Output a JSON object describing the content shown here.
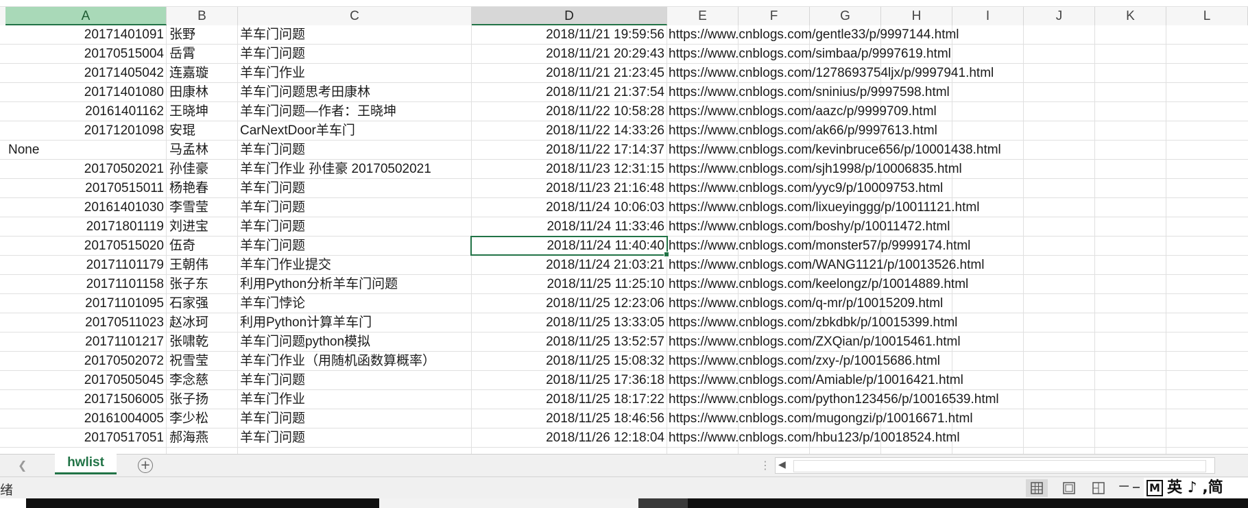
{
  "columns": [
    "A",
    "B",
    "C",
    "D",
    "E",
    "F",
    "G",
    "H",
    "I",
    "J",
    "K",
    "L"
  ],
  "rows": [
    {
      "a": "20171401091",
      "b": "张野",
      "c": "羊车门问题",
      "d": "2018/11/21 19:59:56",
      "e": "https://www.cnblogs.com/gentle33/p/9997144.html"
    },
    {
      "a": "20170515004",
      "b": "岳霄",
      "c": "羊车门问题",
      "d": "2018/11/21 20:29:43",
      "e": "https://www.cnblogs.com/simbaa/p/9997619.html"
    },
    {
      "a": "20171405042",
      "b": "连嘉璇",
      "c": "羊车门作业",
      "d": "2018/11/21 21:23:45",
      "e": "https://www.cnblogs.com/1278693754ljx/p/9997941.html"
    },
    {
      "a": "20171401080",
      "b": "田康林",
      "c": "羊车门问题思考田康林",
      "d": "2018/11/21 21:37:54",
      "e": "https://www.cnblogs.com/sninius/p/9997598.html"
    },
    {
      "a": "20161401162",
      "b": "王晓坤",
      "c": "羊车门问题—作者：王晓坤",
      "d": "2018/11/22 10:58:28",
      "e": "https://www.cnblogs.com/aazc/p/9999709.html"
    },
    {
      "a": "20171201098",
      "b": "安琨",
      "c": "CarNextDoor羊车门",
      "d": "2018/11/22 14:33:26",
      "e": "https://www.cnblogs.com/ak66/p/9997613.html"
    },
    {
      "a": "None",
      "b": "马孟林",
      "c": "羊车门问题",
      "d": "2018/11/22 17:14:37",
      "e": "https://www.cnblogs.com/kevinbruce656/p/10001438.html"
    },
    {
      "a": "20170502021",
      "b": "孙佳豪",
      "c": "羊车门作业 孙佳豪 20170502021",
      "d": "2018/11/23 12:31:15",
      "e": "https://www.cnblogs.com/sjh1998/p/10006835.html"
    },
    {
      "a": "20170515011",
      "b": "杨艳春",
      "c": "羊车门问题",
      "d": "2018/11/23 21:16:48",
      "e": "https://www.cnblogs.com/yyc9/p/10009753.html"
    },
    {
      "a": "20161401030",
      "b": "李雪莹",
      "c": "羊车门问题",
      "d": "2018/11/24 10:06:03",
      "e": "https://www.cnblogs.com/lixueyinggg/p/10011121.html"
    },
    {
      "a": "20171801119",
      "b": "刘进宝",
      "c": "羊车门问题",
      "d": "2018/11/24 11:33:46",
      "e": "https://www.cnblogs.com/boshy/p/10011472.html"
    },
    {
      "a": "20170515020",
      "b": "伍奇",
      "c": "羊车门问题",
      "d": "2018/11/24 11:40:40",
      "e": "https://www.cnblogs.com/monster57/p/9999174.html"
    },
    {
      "a": "20171101179",
      "b": "王朝伟",
      "c": "羊车门作业提交",
      "d": "2018/11/24 21:03:21",
      "e": "https://www.cnblogs.com/WANG1121/p/10013526.html"
    },
    {
      "a": "20171101158",
      "b": "张子东",
      "c": "利用Python分析羊车门问题",
      "d": "2018/11/25 11:25:10",
      "e": "https://www.cnblogs.com/keelongz/p/10014889.html"
    },
    {
      "a": "20171101095",
      "b": "石家强",
      "c": "羊车门悖论",
      "d": "2018/11/25 12:23:06",
      "e": "https://www.cnblogs.com/q-mr/p/10015209.html"
    },
    {
      "a": "20170511023",
      "b": "赵冰珂",
      "c": "利用Python计算羊车门",
      "d": "2018/11/25 13:33:05",
      "e": "https://www.cnblogs.com/zbkdbk/p/10015399.html"
    },
    {
      "a": "20171101217",
      "b": "张啸乾",
      "c": "羊车门问题python模拟",
      "d": "2018/11/25 13:52:57",
      "e": "https://www.cnblogs.com/ZXQian/p/10015461.html"
    },
    {
      "a": "20170502072",
      "b": "祝雪莹",
      "c": "羊车门作业（用随机函数算概率）",
      "d": "2018/11/25 15:08:32",
      "e": "https://www.cnblogs.com/zxy-/p/10015686.html"
    },
    {
      "a": "20170505045",
      "b": "李念慈",
      "c": "羊车门问题",
      "d": "2018/11/25 17:36:18",
      "e": "https://www.cnblogs.com/Amiable/p/10016421.html"
    },
    {
      "a": "20171506005",
      "b": "张子扬",
      "c": "羊车门作业",
      "d": "2018/11/25 18:17:22",
      "e": "https://www.cnblogs.com/python123456/p/10016539.html"
    },
    {
      "a": "20161004005",
      "b": "李少松",
      "c": "羊车门问题",
      "d": "2018/11/25 18:46:56",
      "e": "https://www.cnblogs.com/mugongzi/p/10016671.html"
    },
    {
      "a": "20170517051",
      "b": "郝海燕",
      "c": "羊车门问题",
      "d": "2018/11/26 12:18:04",
      "e": "https://www.cnblogs.com/hbu123/p/10018524.html"
    }
  ],
  "selection": {
    "active_row": 12,
    "active_column": "D",
    "selected_column": "A"
  },
  "sheet_tab": {
    "label": "hwlist"
  },
  "status": {
    "text": "绪"
  },
  "ime": {
    "mode_letter": "M",
    "text": "英 ♪ ,简"
  },
  "colors": {
    "accent": "#217346",
    "selected_header": "#a9d9b8",
    "grid_line": "#e0e0e0"
  }
}
